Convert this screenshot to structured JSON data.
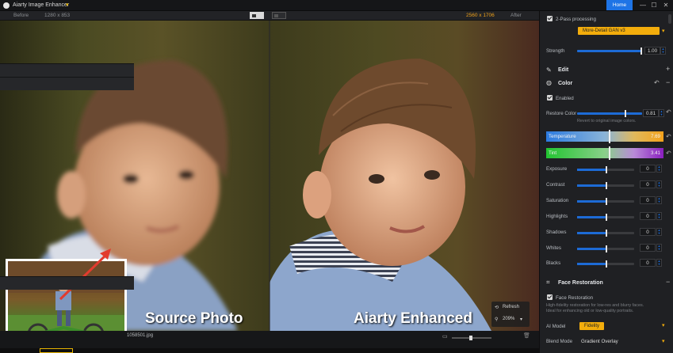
{
  "window": {
    "title": "Aiarty Image Enhancer",
    "home_label": "Home",
    "minimize": "—",
    "maximize": "☐",
    "close": "✕"
  },
  "compare": {
    "before_label": "Before",
    "before_size": "1280 x 853",
    "after_size": "2560 x 1706",
    "after_label": "After"
  },
  "preview": {
    "left_caption": "Source Photo",
    "right_caption": "Aiarty Enhanced",
    "refresh_label": "Refresh",
    "zoom_label": "209%"
  },
  "bottom": {
    "file_name": "1058501.jpg"
  },
  "panel": {
    "two_pass": {
      "label": "2-Pass processing",
      "checked": true
    },
    "model": {
      "value": "More-Detail GAN  v3"
    },
    "strength": {
      "label": "Strength",
      "value": "1.00",
      "level": 1.0
    },
    "edit": {
      "title": "Edit"
    },
    "color": {
      "title": "Color"
    },
    "enabled": {
      "label": "Enabled",
      "checked": true
    },
    "restore_color": {
      "label": "Restore Color",
      "value": "0.81",
      "level": 0.81,
      "hint": "Revert to original image colors."
    },
    "temperature": {
      "label": "Temperature",
      "value": "7.69"
    },
    "tint": {
      "label": "Tint",
      "value": "3.41"
    },
    "adjustments": [
      {
        "label": "Exposure",
        "value": "0"
      },
      {
        "label": "Contrast",
        "value": "0"
      },
      {
        "label": "Saturation",
        "value": "0"
      },
      {
        "label": "Highlights",
        "value": "0"
      },
      {
        "label": "Shadows",
        "value": "0"
      },
      {
        "label": "Whites",
        "value": "0"
      },
      {
        "label": "Blacks",
        "value": "0"
      }
    ],
    "face": {
      "title": "Face Restoration",
      "checkbox_label": "Face Restoration",
      "checked": true,
      "hint1": "High-fidelity restoration for low-res and blurry faces.",
      "hint2": "Ideal for enhancing old or low-quality portraits.",
      "ai_model_label": "AI Model",
      "ai_model_value": "Fidelity",
      "blend_label": "Blend Mode",
      "blend_value": "Gradient Overlay"
    }
  },
  "colors": {
    "accent": "#1e74e6",
    "highlight": "#f3ad0c"
  }
}
